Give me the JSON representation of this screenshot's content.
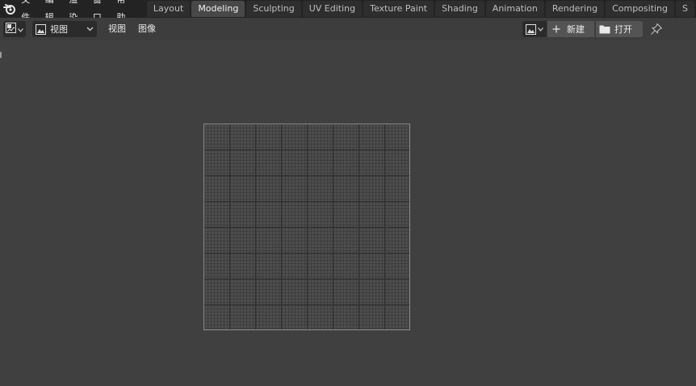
{
  "top_menu": [
    "文件",
    "编辑",
    "渲染",
    "窗口",
    "帮助"
  ],
  "workspace_tabs": [
    {
      "label": "Layout",
      "active": false
    },
    {
      "label": "Modeling",
      "active": true
    },
    {
      "label": "Sculpting",
      "active": false
    },
    {
      "label": "UV Editing",
      "active": false
    },
    {
      "label": "Texture Paint",
      "active": false
    },
    {
      "label": "Shading",
      "active": false
    },
    {
      "label": "Animation",
      "active": false
    },
    {
      "label": "Rendering",
      "active": false
    },
    {
      "label": "Compositing",
      "active": false
    },
    {
      "label": "S",
      "active": false
    }
  ],
  "header": {
    "mode_label": "视图",
    "view_menu": "视图",
    "image_menu": "图像",
    "new_label": "新建",
    "open_label": "打开"
  },
  "icons": [
    "blender-logo-icon",
    "image-editor-icon",
    "image-icon",
    "chevron-down-icon",
    "plus-icon",
    "folder-icon",
    "pin-icon"
  ]
}
